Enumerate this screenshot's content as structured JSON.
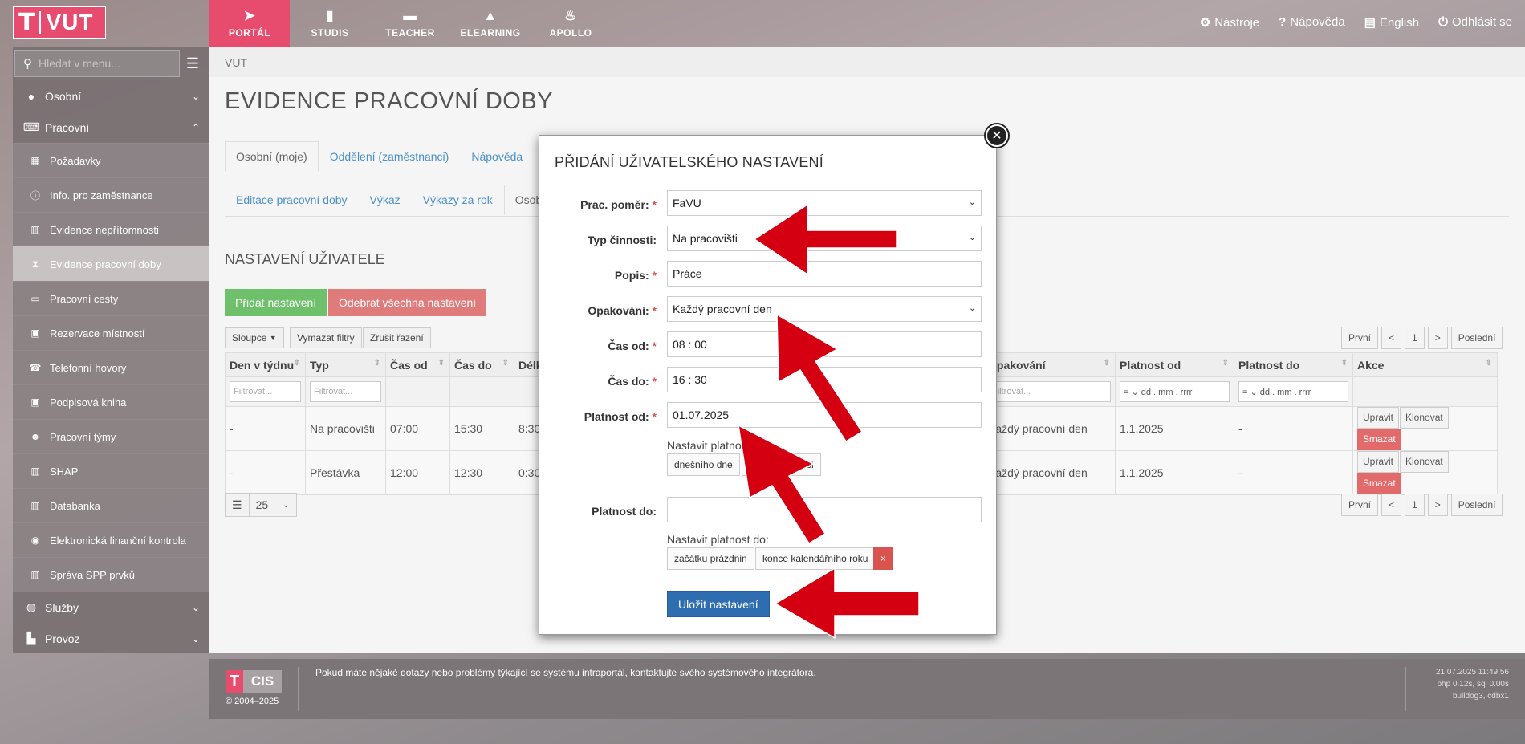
{
  "logo": {
    "letter": "T",
    "text": "VUT"
  },
  "topnav": [
    {
      "label": "PORTÁL",
      "icon": "navigation-icon"
    },
    {
      "label": "STUDIS",
      "icon": "book-icon"
    },
    {
      "label": "TEACHER",
      "icon": "briefcase-icon"
    },
    {
      "label": "ELEARNING",
      "icon": "graduation-cap-icon"
    },
    {
      "label": "APOLLO",
      "icon": "flame-icon"
    }
  ],
  "toplinks": {
    "tools": "Nástroje",
    "help": "Nápověda",
    "language": "English",
    "logout": "Odhlásit se"
  },
  "sidebar": {
    "search_placeholder": "Hledat v menu...",
    "sections": {
      "osobni": "Osobní",
      "pracovni": "Pracovní",
      "sluzby": "Služby",
      "provoz": "Provoz"
    },
    "items": [
      "Požadavky",
      "Info. pro zaměstnance",
      "Evidence nepřítomnosti",
      "Evidence pracovní doby",
      "Pracovní cesty",
      "Rezervace místností",
      "Telefonní hovory",
      "Podpisová kniha",
      "Pracovní týmy",
      "SHAP",
      "Databanka",
      "Elektronická finanční kontrola",
      "Správa SPP prvků"
    ]
  },
  "breadcrumb": "VUT",
  "page_title": "EVIDENCE PRACOVNÍ DOBY",
  "tabs1": [
    "Osobní (moje)",
    "Oddělení (zaměstnanci)",
    "Nápověda"
  ],
  "tabs2": [
    "Editace pracovní doby",
    "Výkaz",
    "Výkazy za rok",
    "Osobní"
  ],
  "section_title": "NASTAVENÍ UŽIVATELE",
  "buttons": {
    "add": "Přidat nastavení",
    "remove_all": "Odebrat všechna nastavení",
    "columns": "Sloupce",
    "clear_filters": "Vymazat filtry",
    "cancel_sort": "Zrušit řazení"
  },
  "pager": {
    "first": "První",
    "prev": "<",
    "page": "1",
    "next": ">",
    "last": "Poslední"
  },
  "table": {
    "headers": [
      "Den v týdnu",
      "Typ",
      "Čas od",
      "Čas do",
      "Délka",
      "Opakování",
      "Platnost od",
      "Platnost do",
      "Akce"
    ],
    "filter_placeholder": "Filtrovat...",
    "filter_op": "=",
    "date_placeholder": "dd . mm . rrrr",
    "rows": [
      [
        "-",
        "Na pracovišti",
        "07:00",
        "15:30",
        "8:30",
        "Každý pracovní den",
        "1.1.2025",
        "-"
      ],
      [
        "-",
        "Přestávka",
        "12:00",
        "12:30",
        "0:30",
        "Každý pracovní den",
        "1.1.2025",
        "-"
      ]
    ],
    "actions": {
      "edit": "Upravit",
      "clone": "Klonovat",
      "delete": "Smazat"
    }
  },
  "page_size": "25",
  "footer": {
    "logo_t": "T",
    "logo_text": "CIS",
    "copyright": "© 2004–2025",
    "text": "Pokud máte nějaké dotazy nebo problémy týkající se systému intraportál, kontaktujte svého",
    "link": "systémového integrátora",
    "meta1": "21.07.2025 11:49:56",
    "meta2": "php 0.12s, sql 0.00s",
    "meta3": "bulldog3, cdbx1"
  },
  "modal": {
    "title": "PŘIDÁNÍ UŽIVATELSKÉHO NASTAVENÍ",
    "labels": {
      "employment": "Prac. poměr:",
      "activity": "Typ činnosti:",
      "description": "Popis:",
      "repeat": "Opakování:",
      "time_from": "Čas od:",
      "time_to": "Čas do:",
      "valid_from": "Platnost od:",
      "valid_to": "Platnost do:"
    },
    "required_mark": "*",
    "values": {
      "employment": "FaVU",
      "activity": "Na pracovišti",
      "description": "Práce",
      "repeat": "Každý pracovní den",
      "time_from": "08 : 00",
      "time_to": "16 : 30",
      "valid_from": "01.07.2025",
      "valid_to": ""
    },
    "hint_from": "Nastavit platnost od:",
    "quick_from": [
      "dnešního dne",
      "1. dne v měsíci"
    ],
    "hint_to": "Nastavit platnost do:",
    "quick_to": [
      "začátku prázdnin",
      "konce kalendářního roku"
    ],
    "quick_to_clear": "×",
    "save": "Uložit nastavení"
  },
  "colors": {
    "brand": "#e74c6f",
    "success": "#6ec06b",
    "danger": "#e07b7b",
    "primary": "#2e6db0",
    "annotation_arrow": "#d40012"
  }
}
